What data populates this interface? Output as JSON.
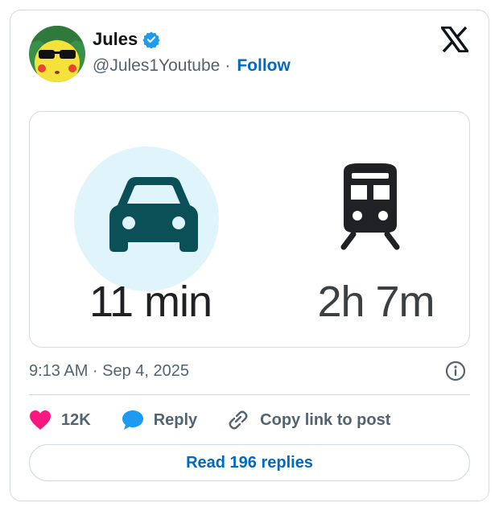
{
  "author": {
    "name": "Jules",
    "handle": "@Jules1Youtube",
    "separator": "·",
    "follow_label": "Follow"
  },
  "media": {
    "car_time": "11 min",
    "train_time": "2h 7m"
  },
  "timestamp": "9:13 AM · Sep 4, 2025",
  "actions": {
    "likes": "12K",
    "reply_label": "Reply",
    "copy_link_label": "Copy link to post"
  },
  "read_replies_label": "Read 196 replies",
  "colors": {
    "link_blue": "#0069c2",
    "like_pink": "#f91880",
    "reply_blue": "#1d9bf0",
    "verified_blue": "#1d9bf0",
    "car_circle": "#dff4fb",
    "car_icon": "#0b4f57"
  },
  "icons": [
    "avatar",
    "verified-badge-icon",
    "x-logo-icon",
    "car-icon",
    "train-icon",
    "info-icon",
    "heart-icon",
    "reply-bubble-icon",
    "link-icon"
  ]
}
